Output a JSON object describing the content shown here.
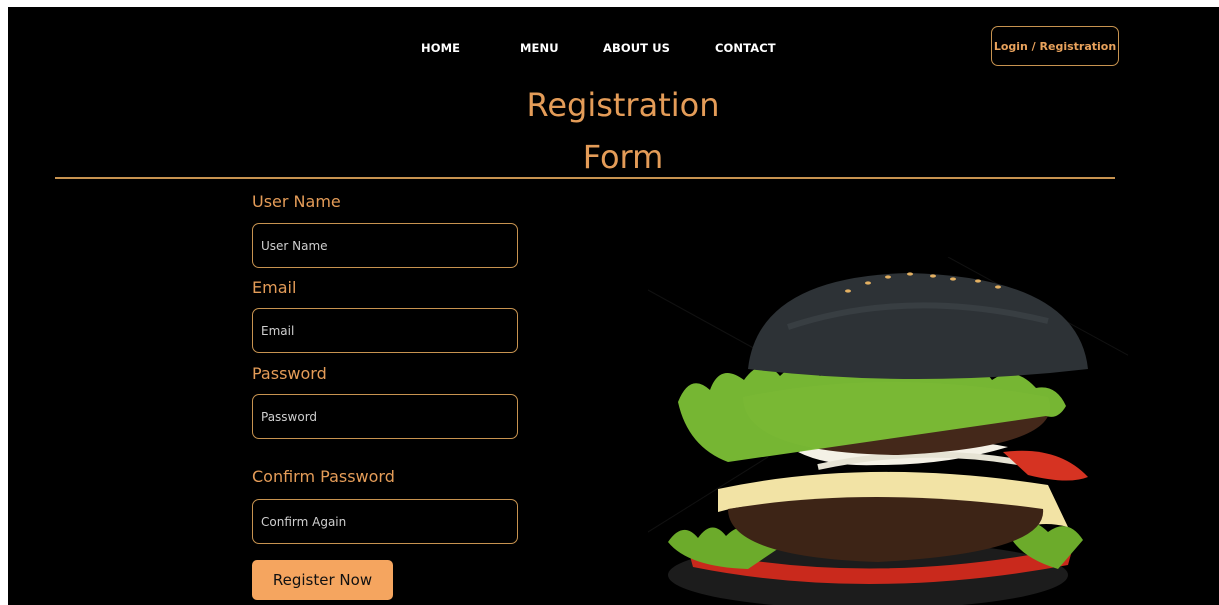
{
  "nav": {
    "items": [
      "HOME",
      "MENU",
      "ABOUT US",
      "CONTACT"
    ],
    "login_label": "Login / Registration"
  },
  "page_title": {
    "line1": "Registration",
    "line2": "Form"
  },
  "form": {
    "username": {
      "label": "User Name",
      "placeholder": "User Name"
    },
    "email": {
      "label": "Email",
      "placeholder": "Email"
    },
    "password": {
      "label": "Password",
      "placeholder": "Password"
    },
    "confirm": {
      "label": "Confirm Password",
      "placeholder": "Confirm Again"
    },
    "submit_label": "Register Now"
  },
  "colors": {
    "accent": "#e49c58",
    "button": "#f5a55f",
    "border": "#c79350",
    "background": "#000000"
  },
  "hero_image": {
    "icon": "burger-illustration"
  }
}
